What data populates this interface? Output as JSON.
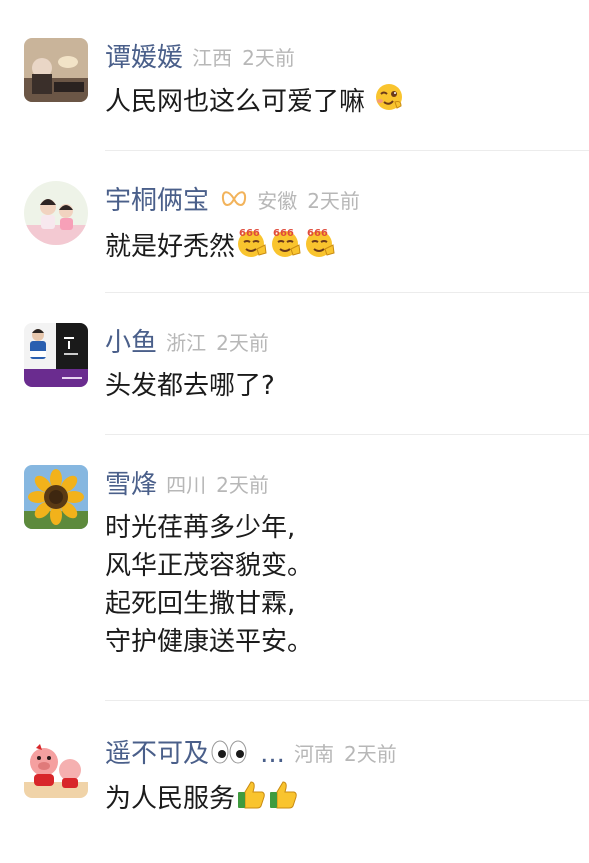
{
  "comments": [
    {
      "username": "谭媛媛",
      "location": "江西",
      "time": "2天前",
      "lines": [
        "人民网也这么可爱了嘛"
      ],
      "avatar_icon": "photo-avatar-icon",
      "emoji": [
        "wink-emoji-icon"
      ]
    },
    {
      "username": "宇桐俩宝",
      "location": "安徽",
      "time": "2天前",
      "lines": [
        "就是好秃然"
      ],
      "avatar_icon": "kids-photo-avatar-icon",
      "badge_icon": "ribbon-badge-icon",
      "emoji": [
        "666-emoji-icon",
        "666-emoji-icon",
        "666-emoji-icon"
      ],
      "emoji_text": "666"
    },
    {
      "username": "小鱼",
      "location": "浙江",
      "time": "2天前",
      "lines": [
        "头发都去哪了?"
      ],
      "avatar_icon": "purple-photo-avatar-icon"
    },
    {
      "username": "雪烽",
      "location": "四川",
      "time": "2天前",
      "lines": [
        "时光荏苒多少年,",
        "风华正茂容貌变。",
        "起死回生撒甘霖,",
        "守护健康送平安。"
      ],
      "avatar_icon": "sunflower-avatar-icon"
    },
    {
      "username": "遥不可及",
      "username_suffix": "...",
      "location": "河南",
      "time": "2天前",
      "lines": [
        "为人民服务"
      ],
      "avatar_icon": "pig-doll-avatar-icon",
      "name_emoji": [
        "eyes-emoji-icon"
      ],
      "emoji": [
        "thumbs-up-emoji-icon",
        "thumbs-up-emoji-icon"
      ]
    }
  ],
  "colors": {
    "username": "#4a5f8a",
    "meta": "#b7b7b7",
    "text": "#1b1b1b",
    "divider": "#ececec"
  }
}
